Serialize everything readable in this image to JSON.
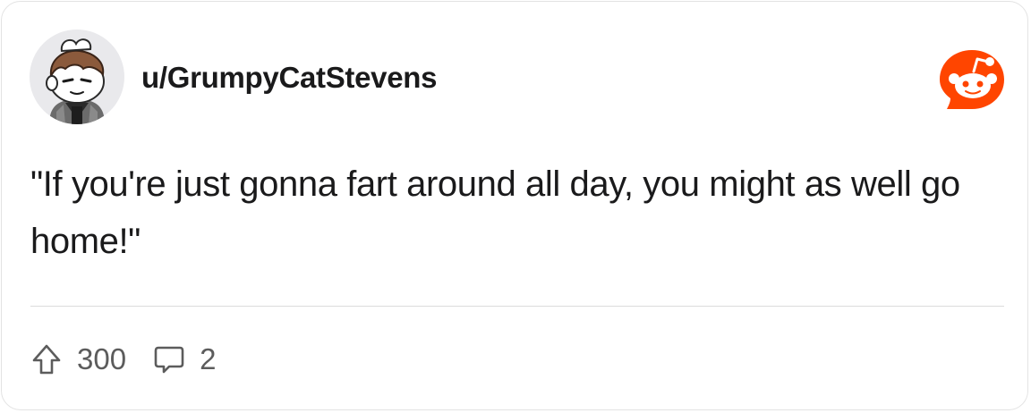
{
  "post": {
    "username": "u/GrumpyCatStevens",
    "body": "\"If you're just gonna fart around all day, you might as well go home!\"",
    "upvotes": "300",
    "comments": "2"
  },
  "icons": {
    "avatar": "user-avatar",
    "brand": "reddit-logo-icon",
    "upvote": "upvote-arrow-icon",
    "comment": "comment-bubble-icon"
  },
  "colors": {
    "brand": "#ff4500",
    "text": "#1a1a1b",
    "muted": "#5c5c5c",
    "border": "#e3e3e3"
  }
}
